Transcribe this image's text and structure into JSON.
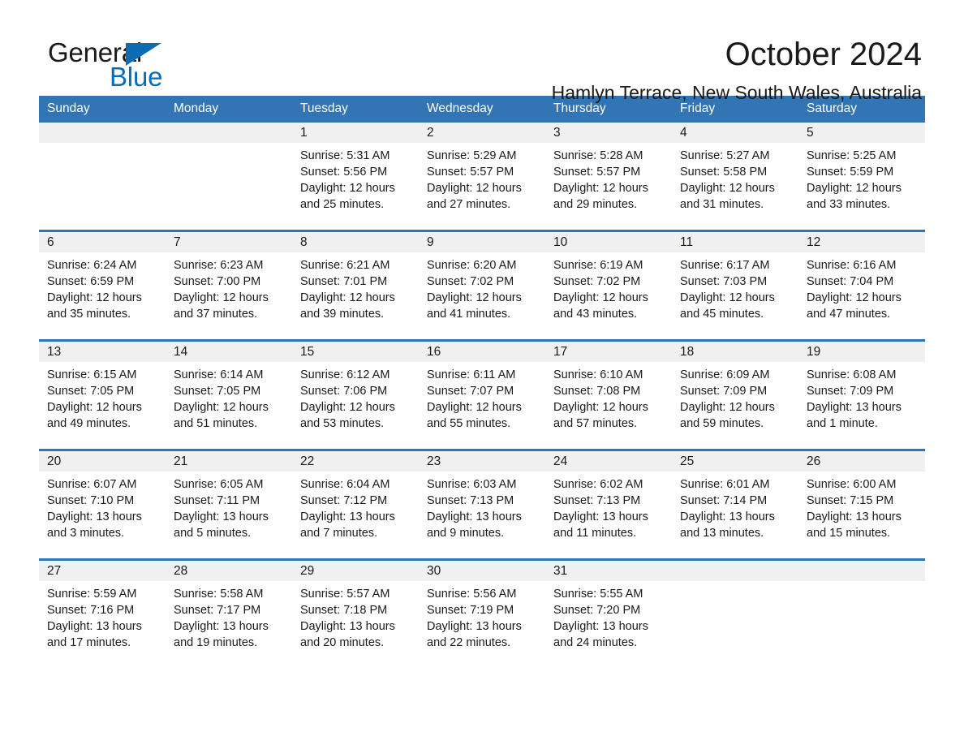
{
  "brand": {
    "name_part1": "General",
    "name_part2": "Blue",
    "accent_color": "#0b6cb3"
  },
  "header": {
    "title": "October 2024",
    "subtitle": "Hamlyn Terrace, New South Wales, Australia"
  },
  "theme": {
    "header_blue": "#3275b5",
    "row_rule_blue": "#2e75b6",
    "daynum_band": "#f0f0f0"
  },
  "weekdays": [
    {
      "label": "Sunday"
    },
    {
      "label": "Monday"
    },
    {
      "label": "Tuesday"
    },
    {
      "label": "Wednesday"
    },
    {
      "label": "Thursday"
    },
    {
      "label": "Friday"
    },
    {
      "label": "Saturday"
    }
  ],
  "weeks": [
    {
      "days": [
        {
          "date": "",
          "sunrise": "",
          "sunset": "",
          "daylight_line1": "",
          "daylight_line2": ""
        },
        {
          "date": "",
          "sunrise": "",
          "sunset": "",
          "daylight_line1": "",
          "daylight_line2": ""
        },
        {
          "date": "1",
          "sunrise": "Sunrise: 5:31 AM",
          "sunset": "Sunset: 5:56 PM",
          "daylight_line1": "Daylight: 12 hours",
          "daylight_line2": "and 25 minutes."
        },
        {
          "date": "2",
          "sunrise": "Sunrise: 5:29 AM",
          "sunset": "Sunset: 5:57 PM",
          "daylight_line1": "Daylight: 12 hours",
          "daylight_line2": "and 27 minutes."
        },
        {
          "date": "3",
          "sunrise": "Sunrise: 5:28 AM",
          "sunset": "Sunset: 5:57 PM",
          "daylight_line1": "Daylight: 12 hours",
          "daylight_line2": "and 29 minutes."
        },
        {
          "date": "4",
          "sunrise": "Sunrise: 5:27 AM",
          "sunset": "Sunset: 5:58 PM",
          "daylight_line1": "Daylight: 12 hours",
          "daylight_line2": "and 31 minutes."
        },
        {
          "date": "5",
          "sunrise": "Sunrise: 5:25 AM",
          "sunset": "Sunset: 5:59 PM",
          "daylight_line1": "Daylight: 12 hours",
          "daylight_line2": "and 33 minutes."
        }
      ]
    },
    {
      "days": [
        {
          "date": "6",
          "sunrise": "Sunrise: 6:24 AM",
          "sunset": "Sunset: 6:59 PM",
          "daylight_line1": "Daylight: 12 hours",
          "daylight_line2": "and 35 minutes."
        },
        {
          "date": "7",
          "sunrise": "Sunrise: 6:23 AM",
          "sunset": "Sunset: 7:00 PM",
          "daylight_line1": "Daylight: 12 hours",
          "daylight_line2": "and 37 minutes."
        },
        {
          "date": "8",
          "sunrise": "Sunrise: 6:21 AM",
          "sunset": "Sunset: 7:01 PM",
          "daylight_line1": "Daylight: 12 hours",
          "daylight_line2": "and 39 minutes."
        },
        {
          "date": "9",
          "sunrise": "Sunrise: 6:20 AM",
          "sunset": "Sunset: 7:02 PM",
          "daylight_line1": "Daylight: 12 hours",
          "daylight_line2": "and 41 minutes."
        },
        {
          "date": "10",
          "sunrise": "Sunrise: 6:19 AM",
          "sunset": "Sunset: 7:02 PM",
          "daylight_line1": "Daylight: 12 hours",
          "daylight_line2": "and 43 minutes."
        },
        {
          "date": "11",
          "sunrise": "Sunrise: 6:17 AM",
          "sunset": "Sunset: 7:03 PM",
          "daylight_line1": "Daylight: 12 hours",
          "daylight_line2": "and 45 minutes."
        },
        {
          "date": "12",
          "sunrise": "Sunrise: 6:16 AM",
          "sunset": "Sunset: 7:04 PM",
          "daylight_line1": "Daylight: 12 hours",
          "daylight_line2": "and 47 minutes."
        }
      ]
    },
    {
      "days": [
        {
          "date": "13",
          "sunrise": "Sunrise: 6:15 AM",
          "sunset": "Sunset: 7:05 PM",
          "daylight_line1": "Daylight: 12 hours",
          "daylight_line2": "and 49 minutes."
        },
        {
          "date": "14",
          "sunrise": "Sunrise: 6:14 AM",
          "sunset": "Sunset: 7:05 PM",
          "daylight_line1": "Daylight: 12 hours",
          "daylight_line2": "and 51 minutes."
        },
        {
          "date": "15",
          "sunrise": "Sunrise: 6:12 AM",
          "sunset": "Sunset: 7:06 PM",
          "daylight_line1": "Daylight: 12 hours",
          "daylight_line2": "and 53 minutes."
        },
        {
          "date": "16",
          "sunrise": "Sunrise: 6:11 AM",
          "sunset": "Sunset: 7:07 PM",
          "daylight_line1": "Daylight: 12 hours",
          "daylight_line2": "and 55 minutes."
        },
        {
          "date": "17",
          "sunrise": "Sunrise: 6:10 AM",
          "sunset": "Sunset: 7:08 PM",
          "daylight_line1": "Daylight: 12 hours",
          "daylight_line2": "and 57 minutes."
        },
        {
          "date": "18",
          "sunrise": "Sunrise: 6:09 AM",
          "sunset": "Sunset: 7:09 PM",
          "daylight_line1": "Daylight: 12 hours",
          "daylight_line2": "and 59 minutes."
        },
        {
          "date": "19",
          "sunrise": "Sunrise: 6:08 AM",
          "sunset": "Sunset: 7:09 PM",
          "daylight_line1": "Daylight: 13 hours",
          "daylight_line2": "and 1 minute."
        }
      ]
    },
    {
      "days": [
        {
          "date": "20",
          "sunrise": "Sunrise: 6:07 AM",
          "sunset": "Sunset: 7:10 PM",
          "daylight_line1": "Daylight: 13 hours",
          "daylight_line2": "and 3 minutes."
        },
        {
          "date": "21",
          "sunrise": "Sunrise: 6:05 AM",
          "sunset": "Sunset: 7:11 PM",
          "daylight_line1": "Daylight: 13 hours",
          "daylight_line2": "and 5 minutes."
        },
        {
          "date": "22",
          "sunrise": "Sunrise: 6:04 AM",
          "sunset": "Sunset: 7:12 PM",
          "daylight_line1": "Daylight: 13 hours",
          "daylight_line2": "and 7 minutes."
        },
        {
          "date": "23",
          "sunrise": "Sunrise: 6:03 AM",
          "sunset": "Sunset: 7:13 PM",
          "daylight_line1": "Daylight: 13 hours",
          "daylight_line2": "and 9 minutes."
        },
        {
          "date": "24",
          "sunrise": "Sunrise: 6:02 AM",
          "sunset": "Sunset: 7:13 PM",
          "daylight_line1": "Daylight: 13 hours",
          "daylight_line2": "and 11 minutes."
        },
        {
          "date": "25",
          "sunrise": "Sunrise: 6:01 AM",
          "sunset": "Sunset: 7:14 PM",
          "daylight_line1": "Daylight: 13 hours",
          "daylight_line2": "and 13 minutes."
        },
        {
          "date": "26",
          "sunrise": "Sunrise: 6:00 AM",
          "sunset": "Sunset: 7:15 PM",
          "daylight_line1": "Daylight: 13 hours",
          "daylight_line2": "and 15 minutes."
        }
      ]
    },
    {
      "days": [
        {
          "date": "27",
          "sunrise": "Sunrise: 5:59 AM",
          "sunset": "Sunset: 7:16 PM",
          "daylight_line1": "Daylight: 13 hours",
          "daylight_line2": "and 17 minutes."
        },
        {
          "date": "28",
          "sunrise": "Sunrise: 5:58 AM",
          "sunset": "Sunset: 7:17 PM",
          "daylight_line1": "Daylight: 13 hours",
          "daylight_line2": "and 19 minutes."
        },
        {
          "date": "29",
          "sunrise": "Sunrise: 5:57 AM",
          "sunset": "Sunset: 7:18 PM",
          "daylight_line1": "Daylight: 13 hours",
          "daylight_line2": "and 20 minutes."
        },
        {
          "date": "30",
          "sunrise": "Sunrise: 5:56 AM",
          "sunset": "Sunset: 7:19 PM",
          "daylight_line1": "Daylight: 13 hours",
          "daylight_line2": "and 22 minutes."
        },
        {
          "date": "31",
          "sunrise": "Sunrise: 5:55 AM",
          "sunset": "Sunset: 7:20 PM",
          "daylight_line1": "Daylight: 13 hours",
          "daylight_line2": "and 24 minutes."
        },
        {
          "date": "",
          "sunrise": "",
          "sunset": "",
          "daylight_line1": "",
          "daylight_line2": ""
        },
        {
          "date": "",
          "sunrise": "",
          "sunset": "",
          "daylight_line1": "",
          "daylight_line2": ""
        }
      ]
    }
  ]
}
